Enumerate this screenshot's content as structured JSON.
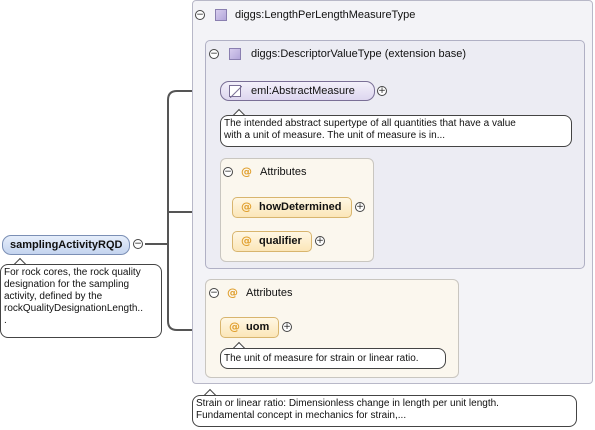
{
  "root": {
    "name": "samplingActivityRQD",
    "doc": [
      "For rock cores, the rock quality",
      "designation for the sampling",
      "activity, defined by the",
      "rockQualityDesignationLength..",
      "."
    ]
  },
  "outer_type": {
    "name": "diggs:LengthPerLengthMeasureType",
    "doc": [
      "Strain or linear ratio: Dimensionless change in length per unit length.",
      "Fundamental concept in mechanics for strain,..."
    ]
  },
  "base_type": {
    "name": "diggs:DescriptorValueType (extension base)",
    "abstract_element": {
      "name": "eml:AbstractMeasure",
      "doc": [
        "The intended abstract supertype of all quantities that have a value",
        "with a unit of measure. The unit of measure is in..."
      ]
    },
    "attributes": {
      "title": "Attributes",
      "items": [
        "howDetermined",
        "qualifier"
      ]
    }
  },
  "own_attributes": {
    "title": "Attributes",
    "uom": {
      "name": "uom",
      "doc": "The unit of measure for strain or linear ratio."
    }
  },
  "icons": {
    "collapse": "−",
    "expand": "+",
    "attribute": "@"
  }
}
